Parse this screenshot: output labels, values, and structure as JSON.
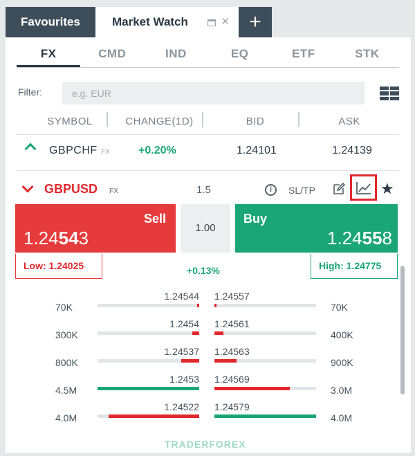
{
  "tabs": {
    "favourites": "Favourites",
    "market_watch": "Market Watch",
    "close": "×",
    "add": "+"
  },
  "categories": [
    "FX",
    "CMD",
    "IND",
    "EQ",
    "ETF",
    "STK"
  ],
  "active_category": "FX",
  "filter": {
    "label": "Filter:",
    "placeholder": "e.g. EUR"
  },
  "columns": [
    "SYMBOL",
    "CHANGE(1D)",
    "BID",
    "ASK"
  ],
  "row_gbpchf": {
    "symbol": "GBPCHF",
    "tag": "FX",
    "change": "+0.20%",
    "bid": "1.24101",
    "ask": "1.24139"
  },
  "gbpusd": {
    "symbol": "GBPUSD",
    "tag": "FX",
    "spread": "1.5",
    "info": "i",
    "sltp": "SL/TP",
    "sell_label": "Sell",
    "sell_price_prefix": "1.24",
    "sell_price_pips": "54",
    "sell_price_suffix": "3",
    "quantity": "1.00",
    "buy_label": "Buy",
    "buy_price_prefix": "1.24",
    "buy_price_pips": "55",
    "buy_price_suffix": "8",
    "low": "Low: 1.24025",
    "high": "High: 1.24775",
    "change": "+0.13%"
  },
  "depth": [
    {
      "bid_vol": "70K",
      "bid": "1.24544",
      "ask": "1.24557",
      "ask_vol": "70K",
      "bid_fill": 0.02,
      "ask_fill": 0.02,
      "bid_color": "#e0282e",
      "ask_color": "#e0282e"
    },
    {
      "bid_vol": "300K",
      "bid": "1.2454",
      "ask": "1.24561",
      "ask_vol": "400K",
      "bid_fill": 0.07,
      "ask_fill": 0.09,
      "bid_color": "#e0282e",
      "ask_color": "#e0282e"
    },
    {
      "bid_vol": "800K",
      "bid": "1.24537",
      "ask": "1.24563",
      "ask_vol": "900K",
      "bid_fill": 0.18,
      "ask_fill": 0.22,
      "bid_color": "#e0282e",
      "ask_color": "#e0282e"
    },
    {
      "bid_vol": "4.5M",
      "bid": "1.2453",
      "ask": "1.24569",
      "ask_vol": "3.0M",
      "bid_fill": 1.0,
      "ask_fill": 0.74,
      "bid_color": "#1aa676",
      "ask_color": "#e0282e"
    },
    {
      "bid_vol": "4.0M",
      "bid": "1.24522",
      "ask": "1.24579",
      "ask_vol": "4.0M",
      "bid_fill": 0.89,
      "ask_fill": 1.0,
      "bid_color": "#e0282e",
      "ask_color": "#1aa676"
    }
  ],
  "watermark": "TRADERFOREX",
  "colors": {
    "sell": "#e63b3c",
    "buy": "#1aa676",
    "tab_dark": "#3d4e5a",
    "highlight_box": "#e0282e"
  },
  "icons": [
    "window-icon",
    "close-icon",
    "add-icon",
    "grid-view-icon",
    "chevron-up-icon",
    "chevron-down-icon",
    "info-icon",
    "edit-icon",
    "chart-icon",
    "star-icon"
  ]
}
